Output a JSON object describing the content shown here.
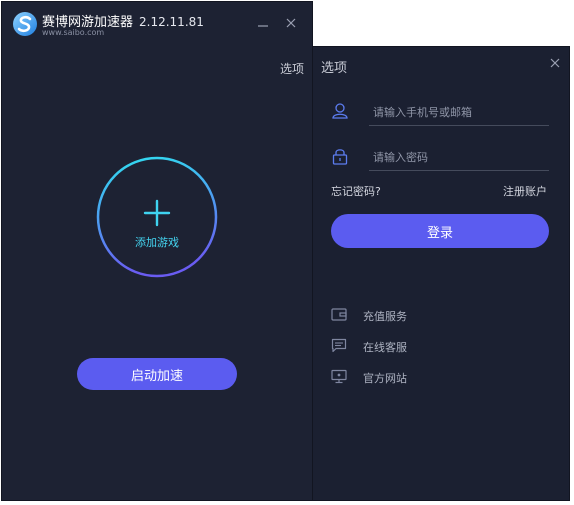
{
  "main_window": {
    "app_name": "赛博网游加速器",
    "version": "2.12.11.81",
    "url": "www.saibo.com",
    "options_label": "选项",
    "add_game_label": "添加游戏",
    "start_label": "启动加速"
  },
  "options_window": {
    "title": "选项",
    "phone_placeholder": "请输入手机号或邮箱",
    "password_placeholder": "请输入密码",
    "forgot_label": "忘记密码?",
    "register_label": "注册账户",
    "login_label": "登录",
    "menu": [
      {
        "label": "充值服务",
        "icon": "wallet-icon"
      },
      {
        "label": "在线客服",
        "icon": "chat-icon"
      },
      {
        "label": "官方网站",
        "icon": "monitor-icon"
      }
    ]
  },
  "colors": {
    "background": "#1d2233",
    "accent": "#5b5cf0",
    "circle_gradient_start": "#2fe0f0",
    "circle_gradient_end": "#6a5cf2"
  }
}
